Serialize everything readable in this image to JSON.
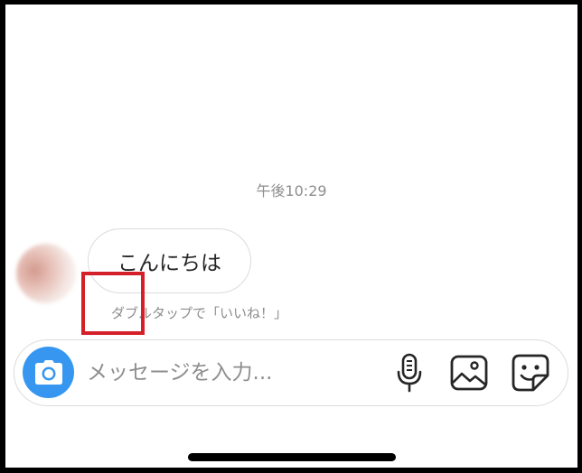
{
  "chat": {
    "timestamp": "午後10:29",
    "message_text": "こんにちは",
    "like_hint": "ダブルタップで「いいね！」"
  },
  "composer": {
    "placeholder": "メッセージを入力..."
  },
  "icons": {
    "camera": "camera-icon",
    "microphone": "microphone-icon",
    "gallery": "gallery-icon",
    "sticker": "sticker-icon"
  },
  "colors": {
    "accent": "#3797f0",
    "highlight": "#d32029",
    "secondary_text": "#8e8e8e",
    "border": "#dbdbdb"
  }
}
